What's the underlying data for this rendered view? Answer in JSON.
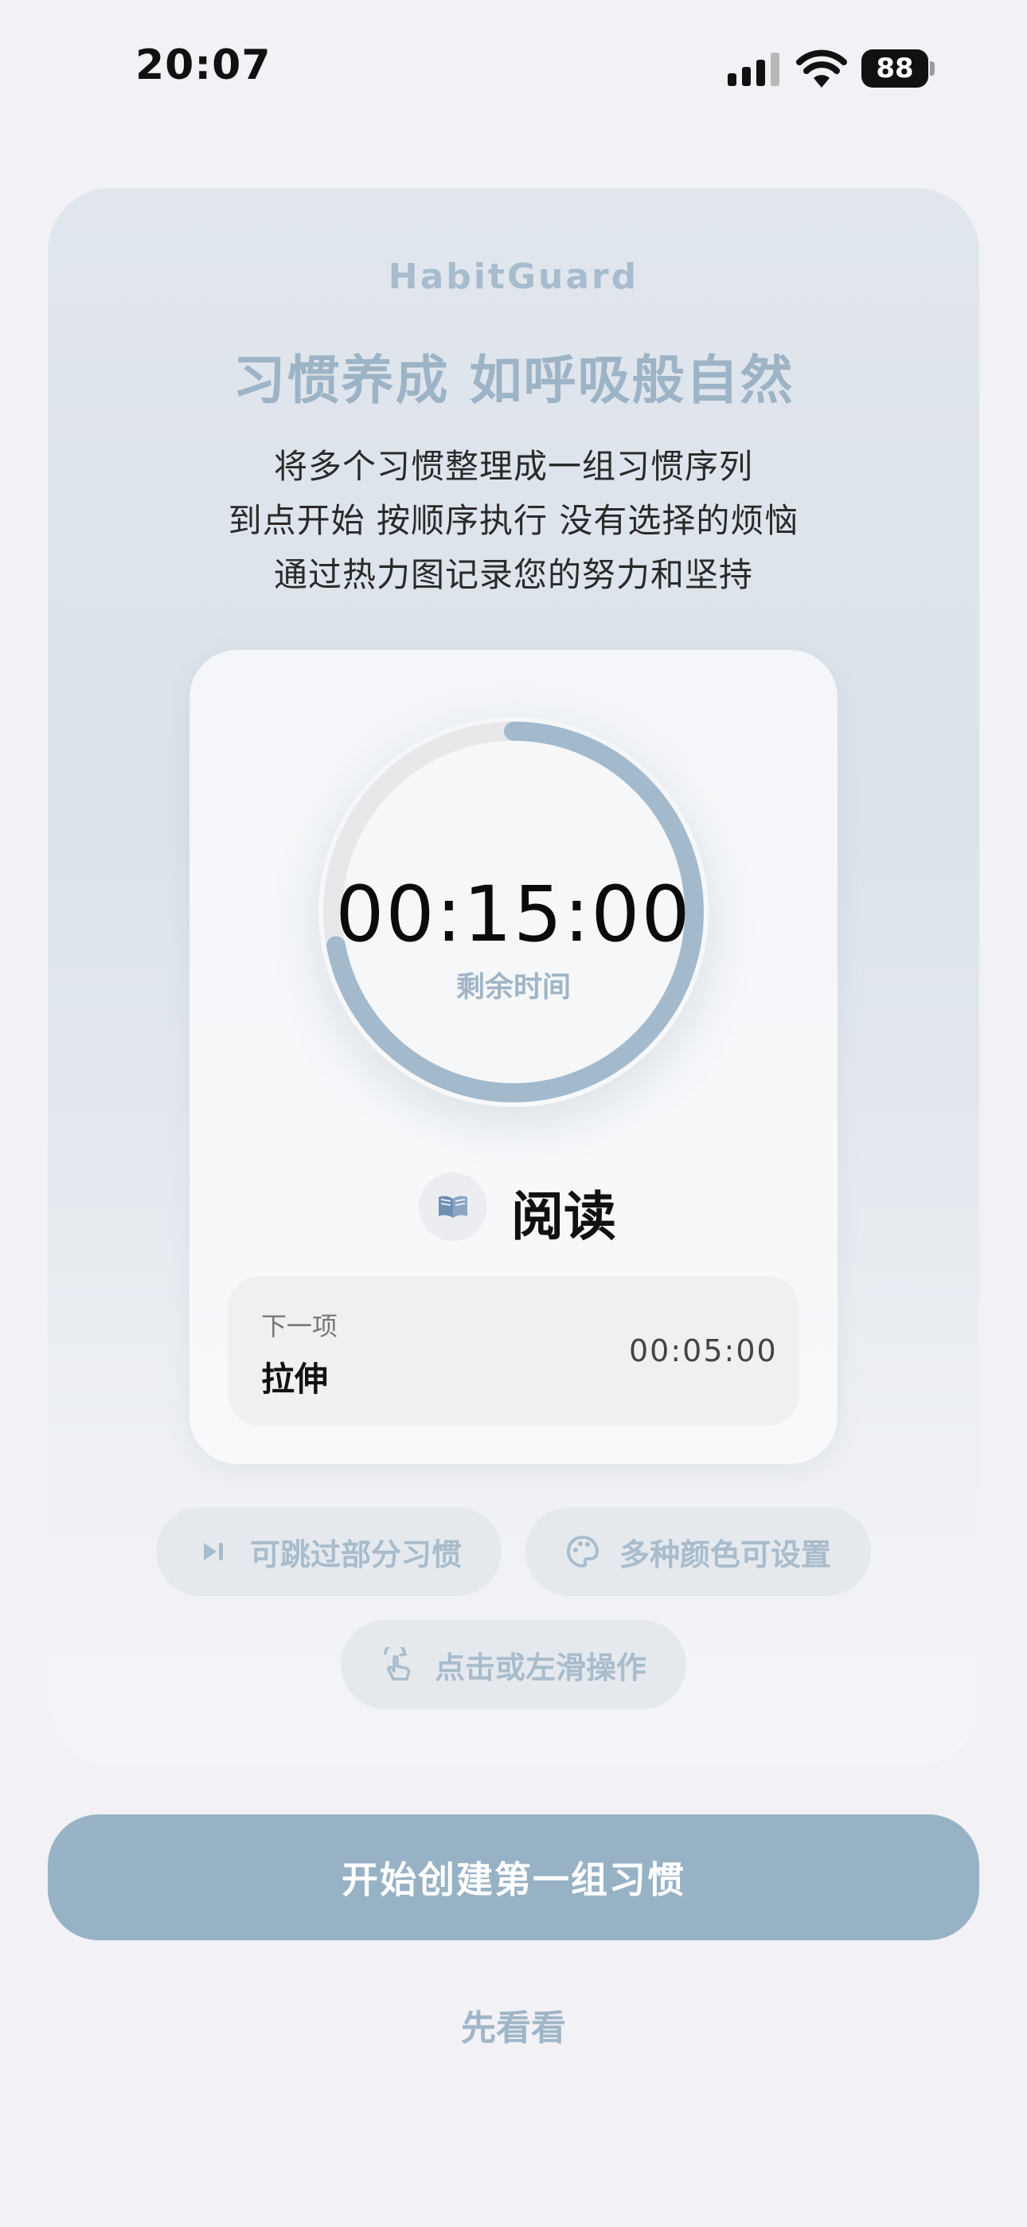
{
  "status_bar": {
    "time": "20:07",
    "battery": "88"
  },
  "intro": {
    "brand": "HabitGuard",
    "headline": "习惯养成 如呼吸般自然",
    "description_lines": [
      "将多个习惯整理成一组习惯序列",
      "到点开始 按顺序执行 没有选择的烦恼",
      "通过热力图记录您的努力和坚持"
    ]
  },
  "timer": {
    "time": "00:15:00",
    "label": "剩余时间",
    "progress": 0.72,
    "current_habit": {
      "icon": "book-icon",
      "name": "阅读"
    },
    "next": {
      "label": "下一项",
      "name": "拉伸",
      "duration": "00:05:00"
    }
  },
  "features": [
    {
      "icon": "skip-icon",
      "label": "可跳过部分习惯"
    },
    {
      "icon": "palette-icon",
      "label": "多种颜色可设置"
    },
    {
      "icon": "tap-swipe-icon",
      "label": "点击或左滑操作"
    }
  ],
  "actions": {
    "primary": "开始创建第一组习惯",
    "secondary": "先看看"
  },
  "colors": {
    "accent": "#97b2c5",
    "ring_progress": "#a3bacc",
    "ring_track": "#e8e8ea",
    "muted_text": "#a7bccd"
  }
}
